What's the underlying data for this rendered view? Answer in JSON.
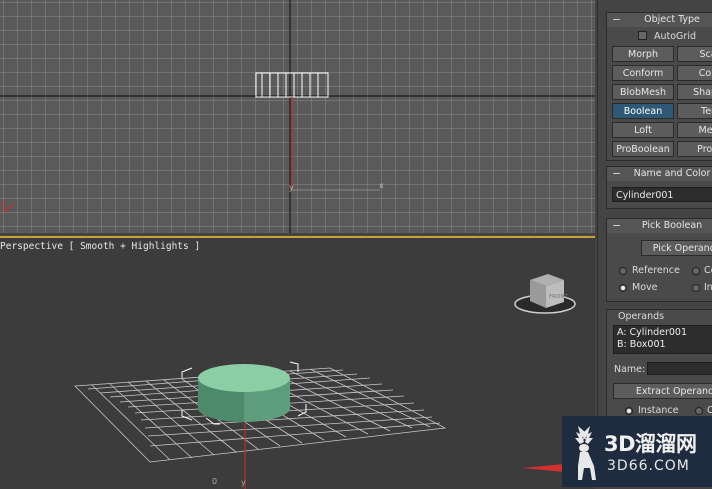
{
  "viewport_top": {},
  "viewport_persp": {
    "label": "Perspective [ Smooth + Highlights ]",
    "viewcube_face": "FRONT"
  },
  "object_type": {
    "title": "Object Type",
    "autogrid_label": "AutoGrid",
    "buttons": [
      "Morph",
      "Sca",
      "Conform",
      "Con",
      "BlobMesh",
      "Shape",
      "Boolean",
      "Ter",
      "Loft",
      "Mes",
      "ProBoolean",
      "ProC"
    ],
    "active_button": "Boolean"
  },
  "name_color": {
    "title": "Name and Color",
    "name_value": "Cylinder001"
  },
  "pick_boolean": {
    "title": "Pick Boolean",
    "pick_button": "Pick Operand B",
    "radio_reference": "Reference",
    "radio_copy": "Co",
    "radio_move": "Move",
    "radio_instance": "In",
    "selected": "Move"
  },
  "operands": {
    "title": "Operands",
    "list": [
      "A: Cylinder001",
      "B: Box001"
    ],
    "name_label": "Name:",
    "extract_button": "Extract Operand",
    "radio_instance": "Instance",
    "radio_copy": "Co",
    "selected": "Instance"
  },
  "watermark": {
    "text": "3D溜溜网",
    "url": "3D66.COM"
  },
  "colors": {
    "viewport_top_bg": "#5a5a5a",
    "viewport_persp_bg": "#3c3c3c",
    "active_border": "#c8a23a",
    "cylinder": "#6fb08c",
    "active_button": "#2f5876",
    "axis_red": "#d23030"
  }
}
